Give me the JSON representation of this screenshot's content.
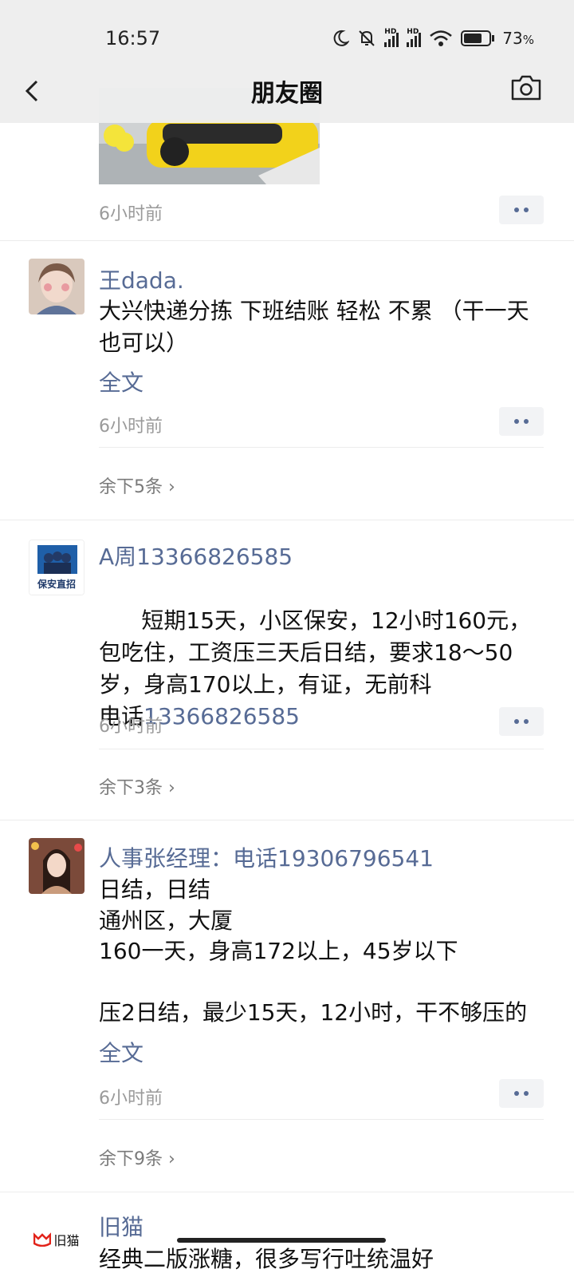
{
  "status_bar": {
    "time": "16:57",
    "battery": "73",
    "battery_unit": "%",
    "hd1": "HD",
    "hd2": "HD"
  },
  "header": {
    "title": "朋友圈"
  },
  "first_post": {
    "time": "6小时前"
  },
  "posts": [
    {
      "name": "王dada.",
      "text": "大兴快递分拣 下班结账 轻松 不累 （干一天也可以）",
      "fulltext": "全文",
      "time": "6小时前",
      "remaining": "余下5条"
    },
    {
      "name": "A周13366826585",
      "avatar_text": "保安直招",
      "text_lines": "短期15天，小区保安，12小时160元，包吃住，工资压三天后日结，要求18～50岁，身高170以上，有证，无前科",
      "phone_prefix": "电话",
      "phone": "13366826585",
      "time": "6小时前",
      "remaining": "余下3条"
    },
    {
      "name": "人事张经理：电话19306796541",
      "text": "日结，日结\n通州区，大厦\n160一天，身高172以上，45岁以下\n\n压2日结，最少15天，12小时，干不够压的",
      "fulltext": "全文",
      "time": "6小时前",
      "remaining": "余下9条"
    },
    {
      "name": "旧猫",
      "logo_text": "旧猫",
      "text": "经典二版涨糖，很多写行吐统温好"
    }
  ]
}
